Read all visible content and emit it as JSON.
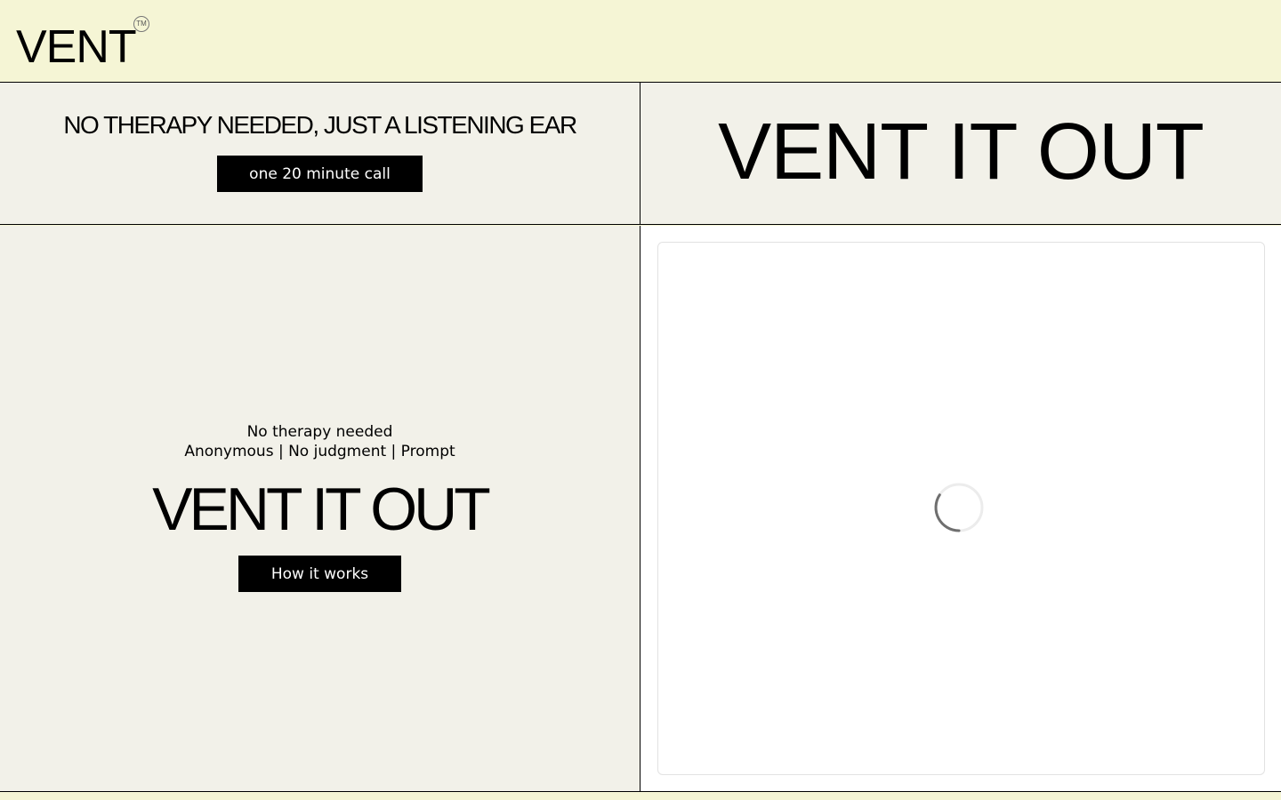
{
  "header": {
    "logo": "VENT",
    "trademark": "TM"
  },
  "top_left": {
    "tagline": "NO THERAPY NEEDED, JUST A LISTENING EAR",
    "call_button_label": "one 20 minute call"
  },
  "top_right": {
    "headline": "VENT IT OUT"
  },
  "bottom_left": {
    "line1": "No therapy needed",
    "line2": "Anonymous | No judgment | Prompt",
    "headline": "VENT IT OUT",
    "how_button_label": "How it works"
  },
  "bottom_right": {
    "loading_icon": "spinner-icon"
  },
  "colors": {
    "header_bg": "#f5f5d5",
    "panel_bg": "#f2f1e9",
    "button_bg": "#000000",
    "button_text": "#ffffff"
  }
}
